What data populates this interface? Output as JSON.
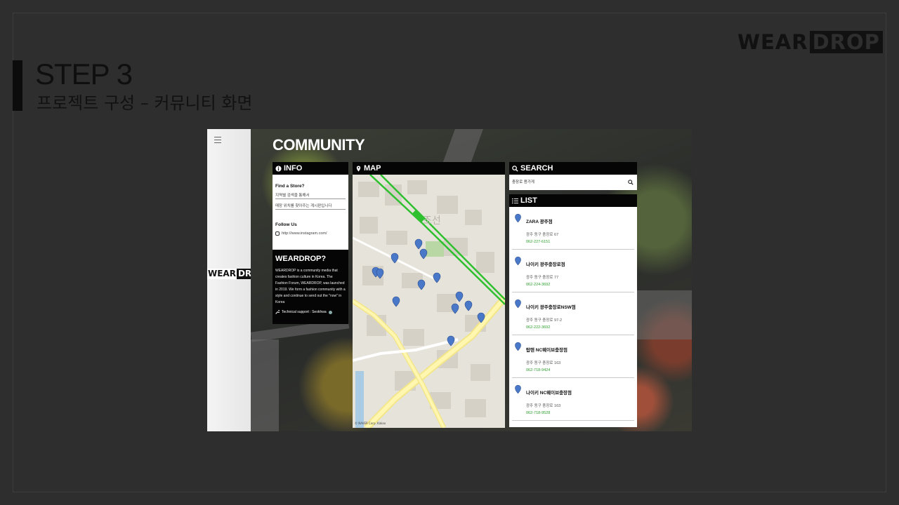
{
  "slide": {
    "brand_logo": {
      "part1": "WEAR",
      "part2": "DROP"
    },
    "step_title": "STEP 3",
    "step_subtitle": "프로젝트 구성 –  커뮤니티 화면"
  },
  "app": {
    "side_logo": {
      "part1": "WEAR",
      "part2": "DROP"
    },
    "title": "COMMUNITY",
    "info": {
      "header": "INFO",
      "find_store_label": "Find a Store?",
      "region_field": "지역별 검색을 통해서",
      "location_field": "매장 위치를 찾아주는 게시판입니다",
      "follow_label": "Follow Us",
      "instagram_url": "http://www.instagram.com/"
    },
    "about": {
      "title": "WEARDROP?",
      "text": "WEARDROP is a community media that creates fashion culture in Korea. The Fashion Forum, WEARDROP, was launched in 2019. We form a fashion community with a style and continue to send out the \"now\" in Korea",
      "tech_support": "Technical support : Seokhwa"
    },
    "map": {
      "header": "MAP",
      "place_label": "조선",
      "attribution": "© NAVER Corp. Kakao"
    },
    "search": {
      "header": "SEARCH",
      "query": "충장로 용가게"
    },
    "list": {
      "header": "LIST",
      "stores": [
        {
          "name": "ZARA 광주점",
          "address": "광주 동구 충장로 67",
          "phone": "062-227-6151"
        },
        {
          "name": "나이키 광주충장로점",
          "address": "광주 동구 충장로 77",
          "phone": "062-224-3692"
        },
        {
          "name": "나이키 광주충장로NSW점",
          "address": "광주 동구 충장로 97-2",
          "phone": "062-222-3692"
        },
        {
          "name": "탑텐 NC웨이브충장점",
          "address": "광주 동구 충장로 163",
          "phone": "062-718-9424"
        },
        {
          "name": "나이키 NC웨이브충장점",
          "address": "광주 동구 충장로 163",
          "phone": "062-718-9528"
        }
      ]
    },
    "icons": [
      "hamburger-icon",
      "info-icon",
      "map-pin-icon",
      "search-icon",
      "list-icon",
      "instagram-icon",
      "wrench-icon"
    ],
    "colors": {
      "accent": "#050505",
      "phone": "#2a9d2a",
      "pin": "#4a78c8",
      "metro_line": "#2fc02f"
    }
  }
}
